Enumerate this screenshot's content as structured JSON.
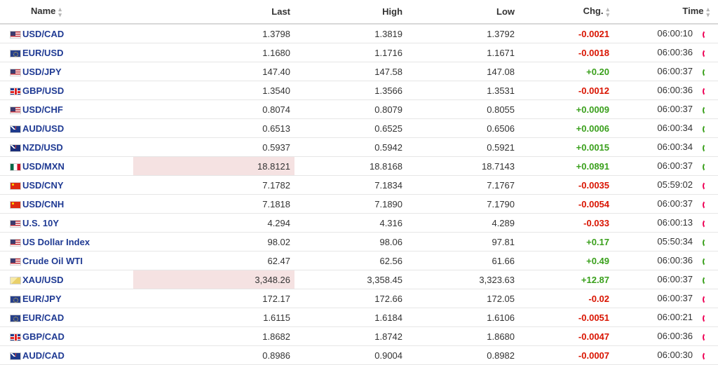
{
  "headers": {
    "name": "Name",
    "last": "Last",
    "high": "High",
    "low": "Low",
    "chg": "Chg.",
    "time": "Time"
  },
  "rows": [
    {
      "flag": "us",
      "name": "USD/CAD",
      "last": "1.3798",
      "high": "1.3819",
      "low": "1.3792",
      "chg": "-0.0021",
      "dir": "down",
      "time": "06:00:10",
      "highlight": false
    },
    {
      "flag": "eu",
      "name": "EUR/USD",
      "last": "1.1680",
      "high": "1.1716",
      "low": "1.1671",
      "chg": "-0.0018",
      "dir": "down",
      "time": "06:00:36",
      "highlight": false
    },
    {
      "flag": "us",
      "name": "USD/JPY",
      "last": "147.40",
      "high": "147.58",
      "low": "147.08",
      "chg": "+0.20",
      "dir": "up",
      "time": "06:00:37",
      "highlight": false
    },
    {
      "flag": "gb",
      "name": "GBP/USD",
      "last": "1.3540",
      "high": "1.3566",
      "low": "1.3531",
      "chg": "-0.0012",
      "dir": "down",
      "time": "06:00:36",
      "highlight": false
    },
    {
      "flag": "us",
      "name": "USD/CHF",
      "last": "0.8074",
      "high": "0.8079",
      "low": "0.8055",
      "chg": "+0.0009",
      "dir": "up",
      "time": "06:00:37",
      "highlight": false
    },
    {
      "flag": "au",
      "name": "AUD/USD",
      "last": "0.6513",
      "high": "0.6525",
      "low": "0.6506",
      "chg": "+0.0006",
      "dir": "up",
      "time": "06:00:34",
      "highlight": false
    },
    {
      "flag": "nz",
      "name": "NZD/USD",
      "last": "0.5937",
      "high": "0.5942",
      "low": "0.5921",
      "chg": "+0.0015",
      "dir": "up",
      "time": "06:00:34",
      "highlight": false
    },
    {
      "flag": "mx",
      "name": "USD/MXN",
      "last": "18.8121",
      "high": "18.8168",
      "low": "18.7143",
      "chg": "+0.0891",
      "dir": "up",
      "time": "06:00:37",
      "highlight": true
    },
    {
      "flag": "cn",
      "name": "USD/CNY",
      "last": "7.1782",
      "high": "7.1834",
      "low": "7.1767",
      "chg": "-0.0035",
      "dir": "down",
      "time": "05:59:02",
      "highlight": false
    },
    {
      "flag": "cn",
      "name": "USD/CNH",
      "last": "7.1818",
      "high": "7.1890",
      "low": "7.1790",
      "chg": "-0.0054",
      "dir": "down",
      "time": "06:00:37",
      "highlight": false
    },
    {
      "flag": "us",
      "name": "U.S. 10Y",
      "last": "4.294",
      "high": "4.316",
      "low": "4.289",
      "chg": "-0.033",
      "dir": "down",
      "time": "06:00:13",
      "highlight": false
    },
    {
      "flag": "us",
      "name": "US Dollar Index",
      "last": "98.02",
      "high": "98.06",
      "low": "97.81",
      "chg": "+0.17",
      "dir": "up",
      "time": "05:50:34",
      "highlight": false
    },
    {
      "flag": "us",
      "name": "Crude Oil WTI",
      "last": "62.47",
      "high": "62.56",
      "low": "61.66",
      "chg": "+0.49",
      "dir": "up",
      "time": "06:00:36",
      "highlight": false
    },
    {
      "flag": "gold",
      "name": "XAU/USD",
      "last": "3,348.26",
      "high": "3,358.45",
      "low": "3,323.63",
      "chg": "+12.87",
      "dir": "up",
      "time": "06:00:37",
      "highlight": true
    },
    {
      "flag": "eu",
      "name": "EUR/JPY",
      "last": "172.17",
      "high": "172.66",
      "low": "172.05",
      "chg": "-0.02",
      "dir": "down",
      "time": "06:00:37",
      "highlight": false
    },
    {
      "flag": "eu",
      "name": "EUR/CAD",
      "last": "1.6115",
      "high": "1.6184",
      "low": "1.6106",
      "chg": "-0.0051",
      "dir": "down",
      "time": "06:00:21",
      "highlight": false
    },
    {
      "flag": "gb",
      "name": "GBP/CAD",
      "last": "1.8682",
      "high": "1.8742",
      "low": "1.8680",
      "chg": "-0.0047",
      "dir": "down",
      "time": "06:00:36",
      "highlight": false
    },
    {
      "flag": "au",
      "name": "AUD/CAD",
      "last": "0.8986",
      "high": "0.9004",
      "low": "0.8982",
      "chg": "-0.0007",
      "dir": "down",
      "time": "06:00:30",
      "highlight": false
    }
  ],
  "colors": {
    "up": "#3aa01c",
    "down": "#d91400",
    "link": "#1f3a93",
    "highlight": "#f5e2e2"
  }
}
